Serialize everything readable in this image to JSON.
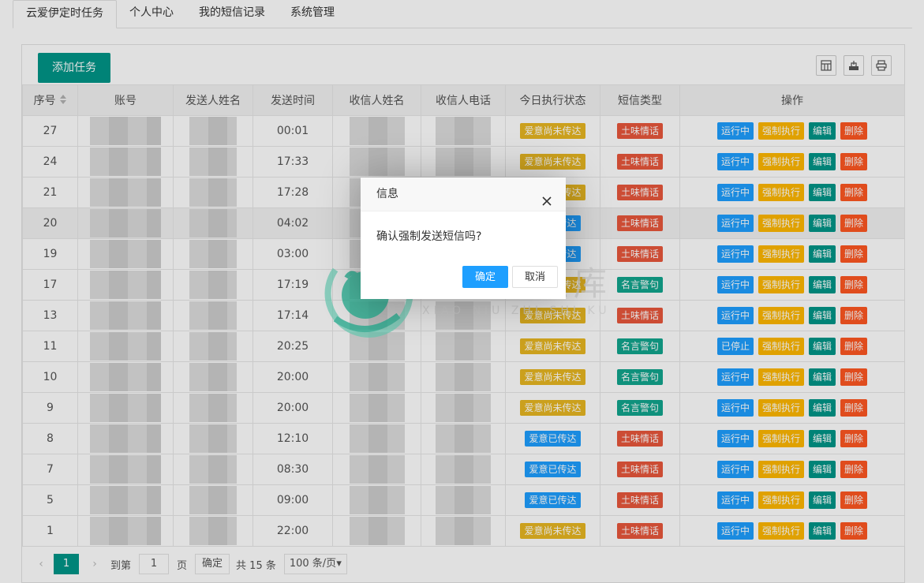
{
  "tabs": [
    "云爱伊定时任务",
    "个人中心",
    "我的短信记录",
    "系统管理"
  ],
  "toolbar": {
    "add_label": "添加任务"
  },
  "table": {
    "headers": [
      "序号",
      "账号",
      "发送人姓名",
      "发送时间",
      "收信人姓名",
      "收信人电话",
      "今日执行状态",
      "短信类型",
      "操作"
    ],
    "rows": [
      {
        "no": "27",
        "time": "00:01",
        "status": "爱意尚未传达",
        "type": "土味情话",
        "run": "运行中"
      },
      {
        "no": "24",
        "time": "17:33",
        "status": "爱意尚未传达",
        "type": "土味情话",
        "run": "运行中"
      },
      {
        "no": "21",
        "time": "17:28",
        "status": "爱意尚未传达",
        "type": "土味情话",
        "run": "运行中"
      },
      {
        "no": "20",
        "time": "04:02",
        "status": "爱意已传达",
        "type": "土味情话",
        "run": "运行中"
      },
      {
        "no": "19",
        "time": "03:00",
        "status": "爱意已传达",
        "type": "土味情话",
        "run": "运行中"
      },
      {
        "no": "17",
        "time": "17:19",
        "status": "爱意尚未传达",
        "type": "名言警句",
        "run": "运行中"
      },
      {
        "no": "13",
        "time": "17:14",
        "status": "爱意尚未传达",
        "type": "土味情话",
        "run": "运行中"
      },
      {
        "no": "11",
        "time": "20:25",
        "status": "爱意尚未传达",
        "type": "名言警句",
        "run": "已停止"
      },
      {
        "no": "10",
        "time": "20:00",
        "status": "爱意尚未传达",
        "type": "名言警句",
        "run": "运行中"
      },
      {
        "no": "9",
        "time": "20:00",
        "status": "爱意尚未传达",
        "type": "名言警句",
        "run": "运行中"
      },
      {
        "no": "8",
        "time": "12:10",
        "status": "爱意已传达",
        "type": "土味情话",
        "run": "运行中"
      },
      {
        "no": "7",
        "time": "08:30",
        "status": "爱意已传达",
        "type": "土味情话",
        "run": "运行中"
      },
      {
        "no": "5",
        "time": "09:00",
        "status": "爱意已传达",
        "type": "土味情话",
        "run": "运行中"
      },
      {
        "no": "1",
        "time": "22:00",
        "status": "爱意尚未传达",
        "type": "土味情话",
        "run": "运行中"
      }
    ],
    "actions": {
      "force": "强制执行",
      "edit": "编辑",
      "delete": "删除"
    }
  },
  "pager": {
    "current": "1",
    "goto_label": "到第",
    "goto_value": "1",
    "page_unit": "页",
    "confirm": "确定",
    "total": "共 15 条",
    "per_page": "100 条/页"
  },
  "dialog": {
    "title": "信息",
    "message": "确认强制发送短信吗?",
    "ok": "确定",
    "cancel": "取消"
  },
  "watermark": {
    "text": "小牛知识库",
    "sub": "XIAO NIU ZHI SHI KU"
  },
  "colors": {
    "primary": "#009688",
    "blue": "#1e9fff",
    "yellow": "#ffb800",
    "red": "#ff5722"
  }
}
